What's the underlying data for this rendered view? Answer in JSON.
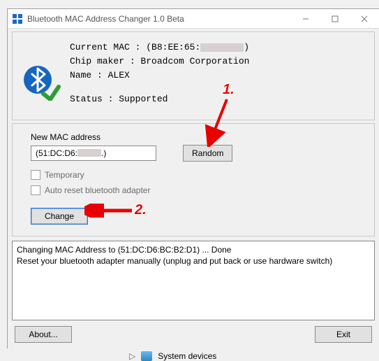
{
  "window": {
    "title": "Bluetooth MAC Address Changer 1.0 Beta"
  },
  "info": {
    "current_mac_label": "Current MAC :",
    "current_mac_prefix": "(B8:EE:65:",
    "current_mac_suffix": ")",
    "chip_maker_label": "Chip maker  :",
    "chip_maker": "Broadcom Corporation",
    "name_label": "Name        :",
    "name": "ALEX",
    "status_label": "Status      :",
    "status": "Supported"
  },
  "mac": {
    "label": "New MAC address",
    "value_prefix": "(51:DC:D6:",
    "value_suffix": ".)",
    "random": "Random",
    "temporary": "Temporary",
    "auto_reset": "Auto reset bluetooth adapter",
    "change": "Change"
  },
  "log": {
    "line1": "Changing MAC Address to (51:DC:D6:BC:B2:D1) ... Done",
    "line2": "Reset your bluetooth adapter manually (unplug and put back or use hardware switch)"
  },
  "buttons": {
    "about": "About...",
    "exit": "Exit"
  },
  "annotations": {
    "one": "1.",
    "two": "2."
  },
  "tree": {
    "item": "System devices"
  }
}
